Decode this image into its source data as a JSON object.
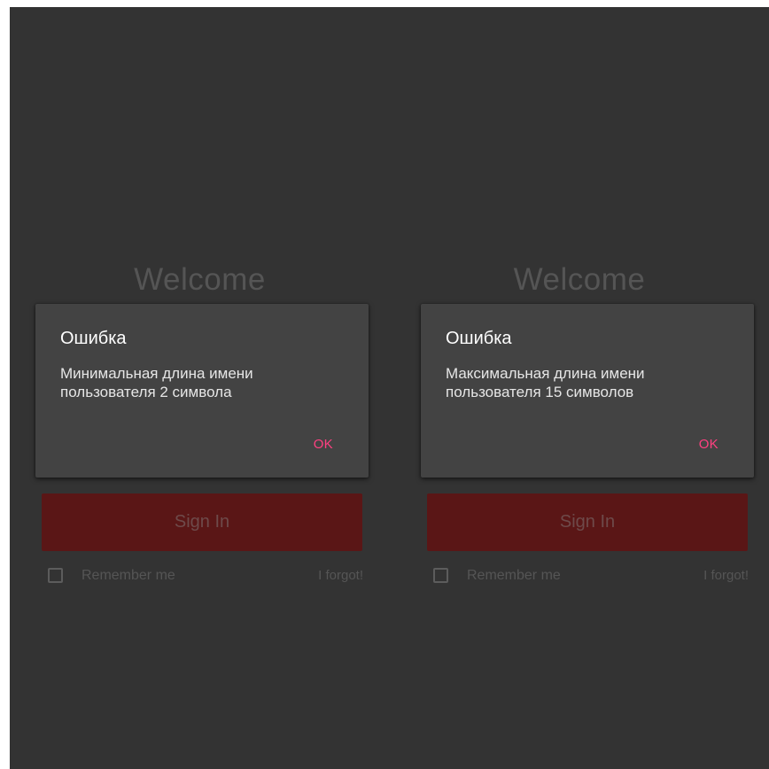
{
  "screens": [
    {
      "welcome": "Welcome",
      "dialog": {
        "title": "Ошибка",
        "message": "Минимальная длина имени пользователя 2 символа",
        "ok_label": "OK"
      },
      "sign_in_label": "Sign In",
      "remember_me_label": "Remember me",
      "forgot_label": "I forgot!"
    },
    {
      "welcome": "Welcome",
      "dialog": {
        "title": "Ошибка",
        "message": "Максимальная длина имени пользователя 15 символов",
        "ok_label": "OK"
      },
      "sign_in_label": "Sign In",
      "remember_me_label": "Remember me",
      "forgot_label": "I forgot!"
    }
  ],
  "colors": {
    "background": "#333333",
    "dialog_background": "#434343",
    "accent": "#ff4081",
    "sign_in_button": "#5a1616"
  }
}
